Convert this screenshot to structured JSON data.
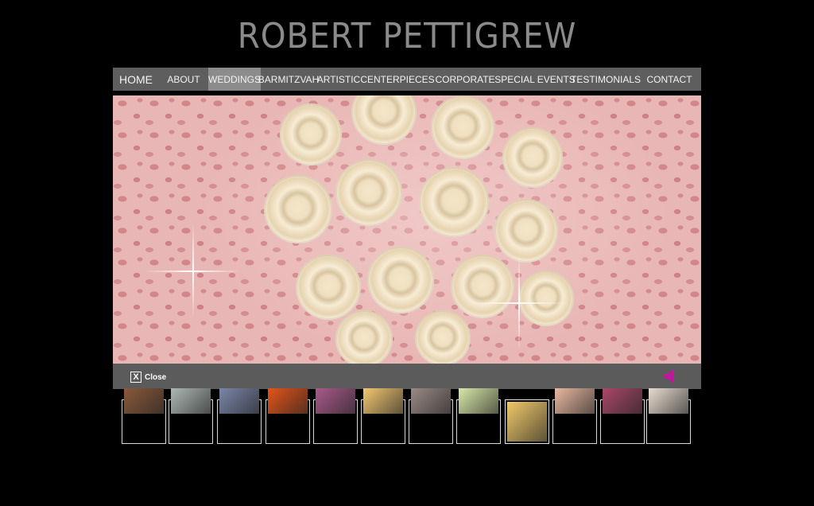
{
  "brand": {
    "title": "ROBERT PETTIGREW"
  },
  "nav": {
    "items": [
      {
        "label": "HOME",
        "active": false
      },
      {
        "label": "ABOUT",
        "active": false
      },
      {
        "label": "WEDDINGS",
        "active": true
      },
      {
        "label": "BARMITZVAH",
        "active": false
      },
      {
        "label": "ARTISTIC",
        "active": false
      },
      {
        "label": "CENTERPIECES",
        "active": false
      },
      {
        "label": "CORPORATE",
        "active": false
      },
      {
        "label": "SPECIAL EVENTS",
        "active": false
      },
      {
        "label": "TESTIMONIALS",
        "active": false
      },
      {
        "label": "CONTACT",
        "active": false
      }
    ]
  },
  "viewer": {
    "close_glyph": "X",
    "close_label": "Close",
    "sound_icon": "speaker-icon",
    "sound_color": "#c0189a"
  },
  "thumbnails": {
    "selected_index": 8,
    "items": [
      {
        "icon": "thumbnail-image",
        "color": "#8a5a3a"
      },
      {
        "icon": "thumbnail-image",
        "color": "#aeb8b4"
      },
      {
        "icon": "thumbnail-image",
        "color": "#7a86a8"
      },
      {
        "icon": "thumbnail-image",
        "color": "#e2541a"
      },
      {
        "icon": "thumbnail-image",
        "color": "#a85a8a"
      },
      {
        "icon": "thumbnail-image",
        "color": "#f2c772"
      },
      {
        "icon": "thumbnail-image",
        "color": "#9a8a86"
      },
      {
        "icon": "thumbnail-image",
        "color": "#d8e8a8"
      },
      {
        "icon": "thumbnail-image",
        "color": "#f0c86a"
      },
      {
        "icon": "thumbnail-image",
        "color": "#e8b8a0"
      },
      {
        "icon": "thumbnail-image",
        "color": "#a84868"
      },
      {
        "icon": "thumbnail-image",
        "color": "#e8dcd0"
      }
    ]
  }
}
